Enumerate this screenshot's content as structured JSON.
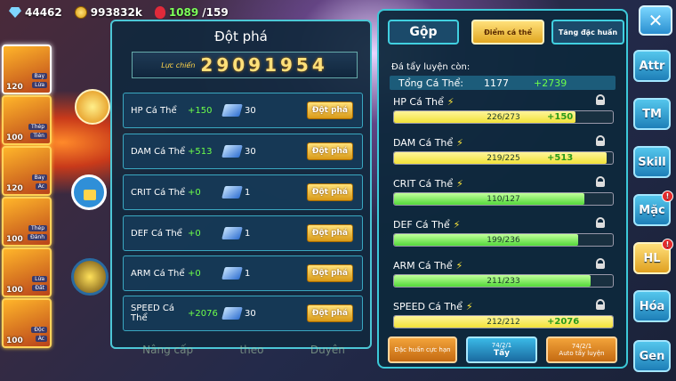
{
  "topbar": {
    "gems": "44462",
    "gold": "993832k",
    "potion": "1089",
    "potion_max": "/159"
  },
  "monsters": [
    {
      "lv": "120",
      "t1": "Bay",
      "t2": "Lửa"
    },
    {
      "lv": "100",
      "t1": "Thép",
      "t2": "Tiên"
    },
    {
      "lv": "120",
      "t1": "Bay",
      "t2": "Ác"
    },
    {
      "lv": "100",
      "t1": "Thép",
      "t2": "Đánh"
    },
    {
      "lv": "100",
      "t1": "Lửa",
      "t2": "Đất"
    },
    {
      "lv": "100",
      "t1": "Độc",
      "t2": "Ác"
    }
  ],
  "panel": {
    "title": "Đột phá",
    "power_label": "Lực chiến",
    "power_value": "29091954",
    "rows": [
      {
        "name": "HP Cá Thể",
        "bonus": "+150",
        "cost": "30",
        "btn": "Đột phá"
      },
      {
        "name": "DAM Cá Thể",
        "bonus": "+513",
        "cost": "30",
        "btn": "Đột phá"
      },
      {
        "name": "CRIT Cá Thể",
        "bonus": "+0",
        "cost": "1",
        "btn": "Đột phá"
      },
      {
        "name": "DEF Cá Thể",
        "bonus": "+0",
        "cost": "1",
        "btn": "Đột phá"
      },
      {
        "name": "ARM Cá Thể",
        "bonus": "+0",
        "cost": "1",
        "btn": "Đột phá"
      },
      {
        "name": "SPEED Cá Thể",
        "bonus": "+2076",
        "cost": "30",
        "btn": "Đột phá"
      }
    ],
    "footer": [
      "Nâng cấp",
      "theo",
      "Duyên"
    ]
  },
  "right": {
    "tabs": [
      "Gộp",
      "Điểm cá thể",
      "Tăng đặc huấn"
    ],
    "sub": "Đá tẩy luyện còn:",
    "total_label": "Tổng Cá Thể:",
    "total": "1177",
    "total_bonus": "+2739",
    "stats": [
      {
        "name": "HP Cá Thể",
        "val": "226/273",
        "bonus": "+150",
        "fill": 0.83,
        "color": "yellow"
      },
      {
        "name": "DAM Cá Thể",
        "val": "219/225",
        "bonus": "+513",
        "fill": 0.97,
        "color": "yellow"
      },
      {
        "name": "CRIT Cá Thể",
        "val": "110/127",
        "bonus": "",
        "fill": 0.87,
        "color": "green"
      },
      {
        "name": "DEF Cá Thể",
        "val": "199/236",
        "bonus": "",
        "fill": 0.84,
        "color": "green"
      },
      {
        "name": "ARM Cá Thể",
        "val": "211/233",
        "bonus": "",
        "fill": 0.9,
        "color": "green"
      },
      {
        "name": "SPEED Cá Thể",
        "val": "212/212",
        "bonus": "+2076",
        "fill": 1.0,
        "color": "yellow"
      }
    ],
    "btn1": "Đặc huấn cực hạn",
    "btn2_count": "74/2/1",
    "btn2": "Tẩy",
    "btn3_count": "74/2/1",
    "btn3": "Auto tẩy luyện"
  },
  "nav": [
    "Attr",
    "TM",
    "Skill",
    "Mặc",
    "HL",
    "Hóa",
    "Gen"
  ],
  "nav_badge": "!"
}
